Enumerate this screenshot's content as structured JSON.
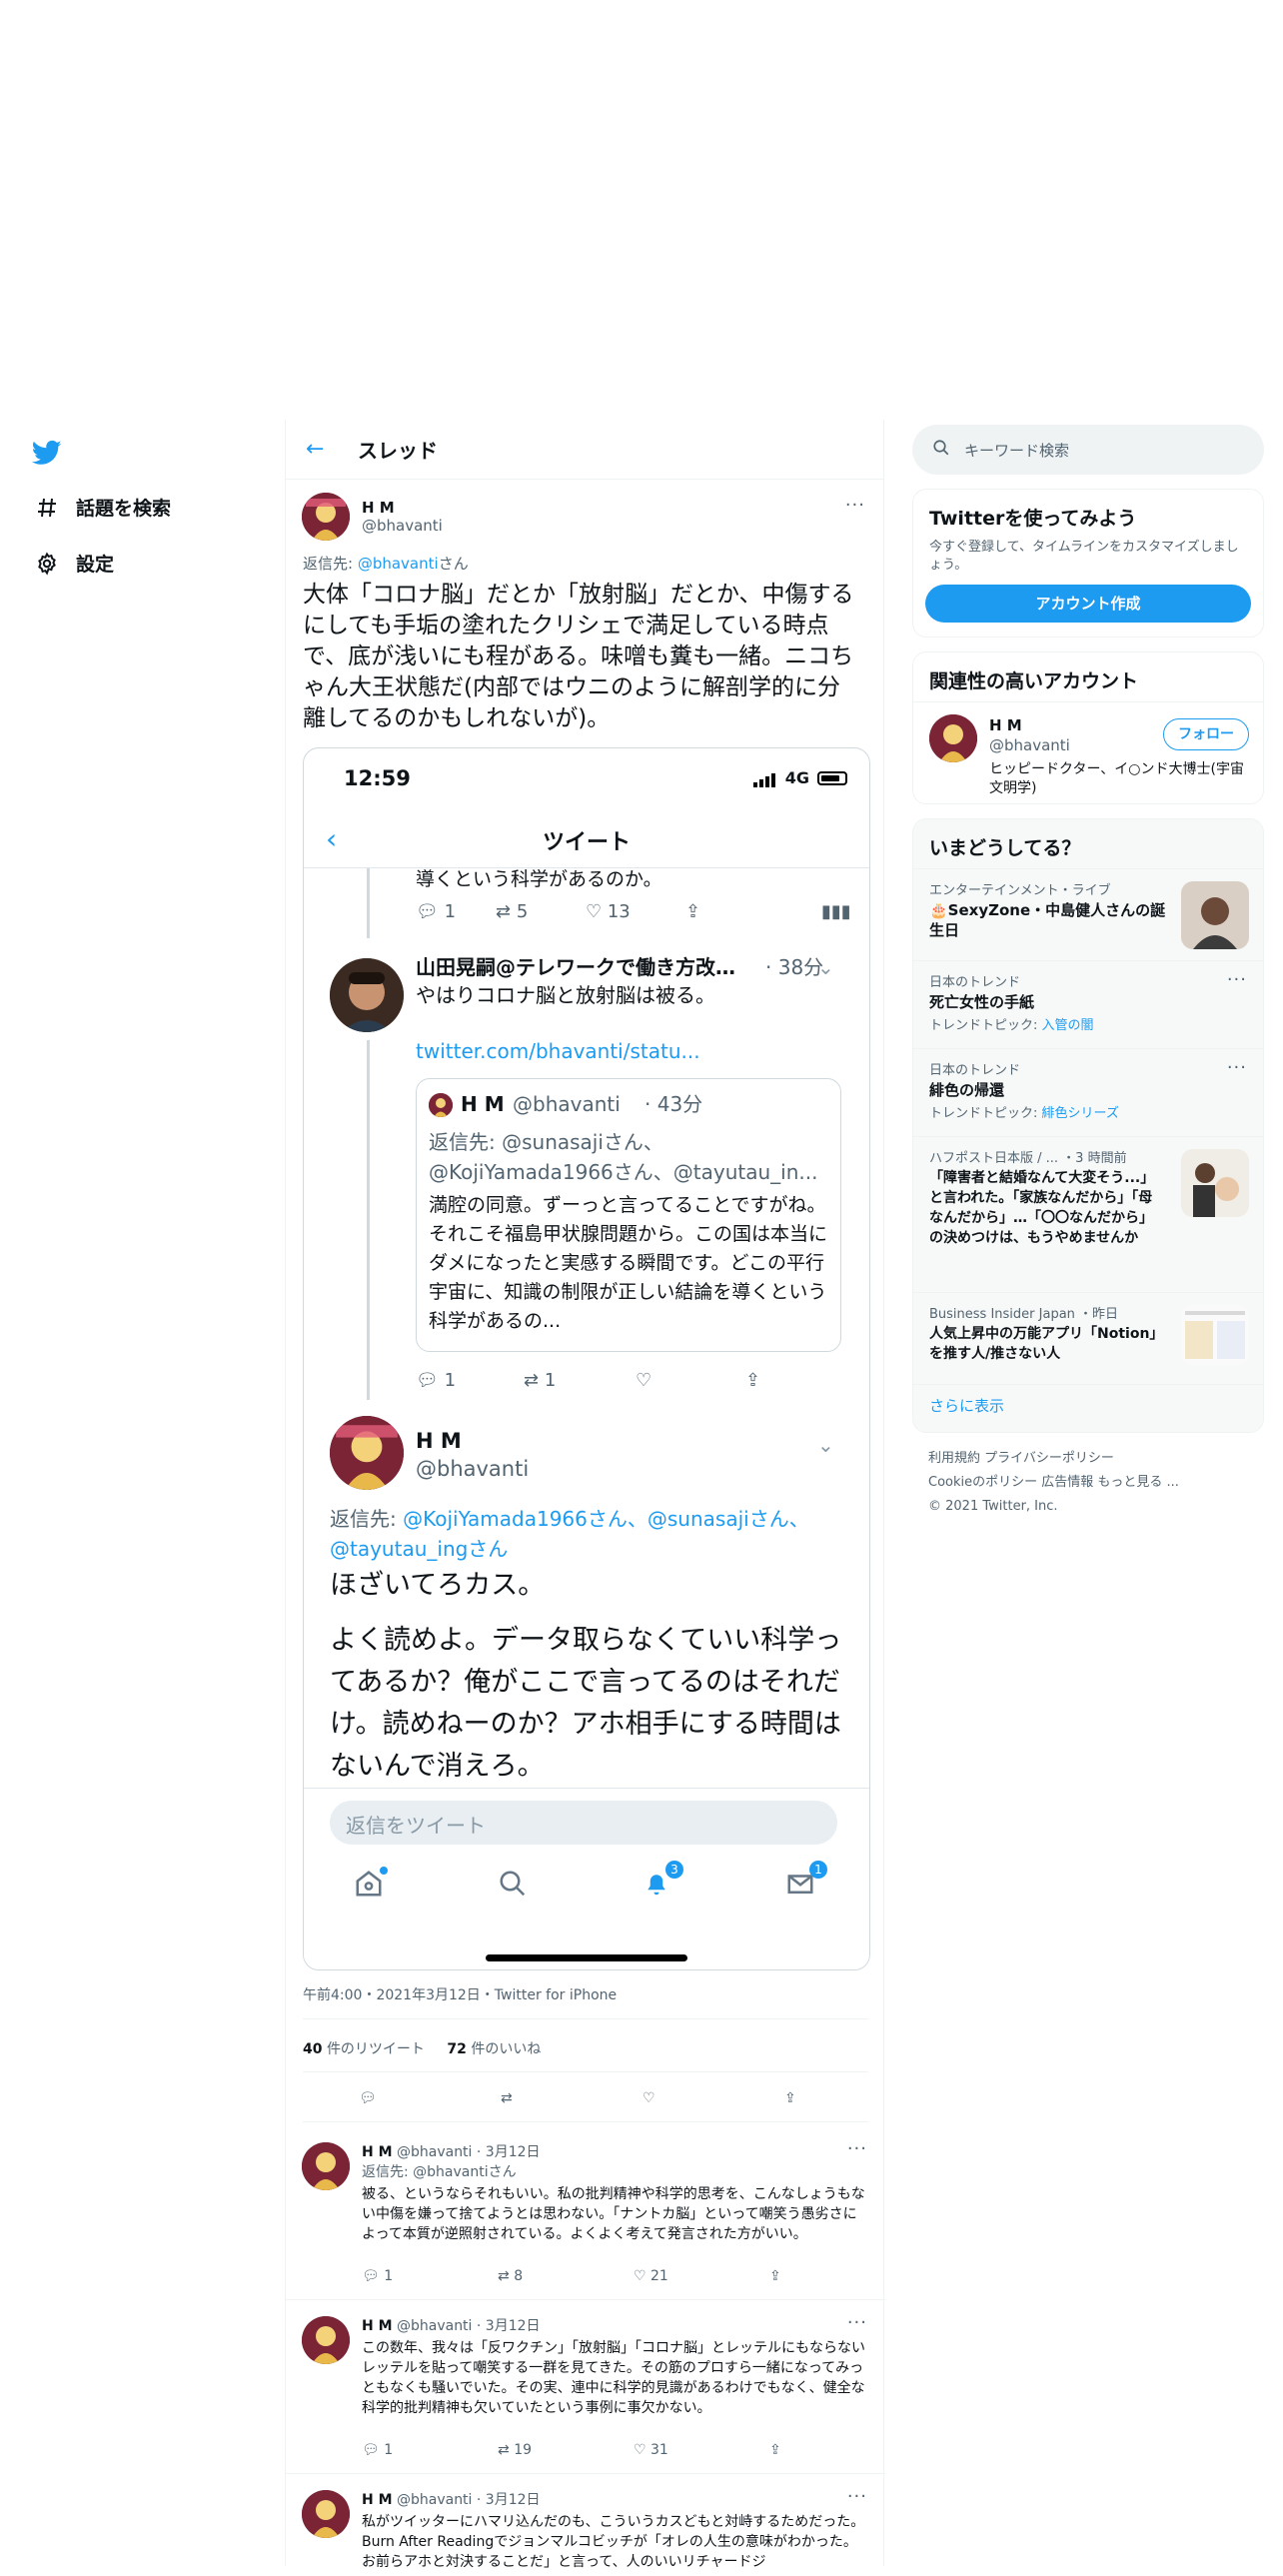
{
  "nav": {
    "items": [
      {
        "icon": "hash-icon",
        "label": "話題を検索"
      },
      {
        "icon": "gear-icon",
        "label": "設定"
      }
    ]
  },
  "header": {
    "title": "スレッド"
  },
  "tweet": {
    "name": "H M",
    "handle": "@bhavanti",
    "reply_prefix": "返信先: ",
    "reply_handle": "@bhavanti",
    "reply_suffix": "さん",
    "text": "大体「コロナ脳」だとか「放射脳」だとか、中傷するにしても手垢の塗れたクリシェで満足している時点で、底が浅いにも程がある。味噌も糞も一緒。ニコちゃん大王状態だ(内部ではウニのように解剖学的に分離してるのかもしれないが)。",
    "meta": "午前4:00・2021年3月12日・Twitter for iPhone",
    "retweets": "40",
    "retweets_label": "件のリツイート",
    "likes": "72",
    "likes_label": "件のいいね"
  },
  "phone": {
    "time": "12:59",
    "network": "4G",
    "title": "ツイート",
    "top_text": "導くという科学があるのか。",
    "top_actions": {
      "reply": "1",
      "retweet": "5",
      "like": "13"
    },
    "t1": {
      "name": "山田晃嗣@テレワークで働き方改…",
      "time": "· 38分",
      "text": "やはりコロナ脳と放射脳は被る。",
      "link": "twitter.com/bhavanti/statu..."
    },
    "quote": {
      "name": "H M",
      "handle": "@bhavanti",
      "time": "· 43分",
      "reply_to_1": "返信先: @sunasajiさん、",
      "reply_to_2": "@KojiYamada1966さん、@tayutau_in...",
      "text": "満腔の同意。ずーっと言ってることですがね。それこそ福島甲状腺問題から。この国は本当にダメになったと実感する瞬間です。どこの平行宇宙に、知識の制限が正しい結論を導くという科学があるの..."
    },
    "t1_actions": {
      "reply": "1",
      "retweet": "1"
    },
    "t2": {
      "name": "H M",
      "handle": "@bhavanti",
      "reply_prefix": "返信先: ",
      "reply_handles": "@KojiYamada1966さん、@sunasajiさん、@tayutau_ingさん",
      "text1": "ほざいてろカス。",
      "text2": "よく読めよ。データ取らなくていい科学ってあるか？俺がここで言ってるのはそれだけ。読めねーのか？アホ相手にする時間はないんで消えろ。"
    },
    "reply_placeholder": "返信をツイート",
    "notif_badge": "3",
    "dm_badge": "1"
  },
  "replies": [
    {
      "name": "H M",
      "handle": "@bhavanti",
      "date": "· 3月12日",
      "reply_to": "返信先: @bhavantiさん",
      "text": "被る、というならそれもいい。私の批判精神や科学的思考を、こんなしょうもない中傷を嫌って捨てようとは思わない。「ナントカ脳」といって嘲笑う愚劣さによって本質が逆照射されている。よくよく考えて発言された方がいい。",
      "reply": "1",
      "retweet": "8",
      "like": "21"
    },
    {
      "name": "H M",
      "handle": "@bhavanti",
      "date": "· 3月12日",
      "reply_to": "",
      "text": "この数年、我々は「反ワクチン」「放射脳」「コロナ脳」とレッテルにもならないレッテルを貼って嘲笑する一群を見てきた。その筋のプロすら一緒になってみっともなくも騒いでいた。その実、連中に科学的見識があるわけでもなく、健全な科学的批判精神も欠いていたという事例に事欠かない。",
      "reply": "1",
      "retweet": "19",
      "like": "31"
    },
    {
      "name": "H M",
      "handle": "@bhavanti",
      "date": "· 3月12日",
      "reply_to": "",
      "text": "私がツイッターにハマリ込んだのも、こういうカスどもと対峙するためだった。Burn After Readingでジョンマルコビッチが「オレの人生の意味がわかった。お前らアホと対決することだ」と言って、人のいいリチャードジ",
      "reply": "",
      "retweet": "",
      "like": ""
    }
  ],
  "right": {
    "search_placeholder": "キーワード検索",
    "signup": {
      "title": "Twitterを使ってみよう",
      "desc": "今すぐ登録して、タイムラインをカスタマイズしましょう。",
      "button": "アカウント作成"
    },
    "related": {
      "title": "関連性の高いアカウント",
      "name": "H M",
      "handle": "@bhavanti",
      "follow": "フォロー",
      "bio": "ヒッピードクター、イ○ンド大博士(宇宙文明学)"
    },
    "trends": {
      "title": "いまどうしてる？",
      "items": [
        {
          "cat": "エンターテインメント・ライブ",
          "title": "🎂SexyZone・中島健人さんの誕生日",
          "sub": ""
        },
        {
          "cat": "日本のトレンド",
          "title": "死亡女性の手紙",
          "sub": "トレンドトピック: ",
          "sub_link": "入管の闇"
        },
        {
          "cat": "日本のトレンド",
          "title": "緋色の帰還",
          "sub": "トレンドトピック: ",
          "sub_link": "緋色シリーズ"
        },
        {
          "cat": "ハフポスト日本版 / ... ・3 時間前",
          "title": "「障害者と結婚なんて大変そう...」と言われた。「家族なんだから」「母なんだから」…「〇〇なんだから」の決めつけは、もうやめませんか",
          "sub": ""
        },
        {
          "cat": "Business Insider Japan ・昨日",
          "title": "人気上昇中の万能アプリ「Notion」を推す人/推さない人",
          "sub": ""
        }
      ],
      "show_more": "さらに表示"
    },
    "footer": {
      "line1": "利用規約   プライバシーポリシー",
      "line2": "Cookieのポリシー   広告情報   もっと見る ...",
      "line3": "© 2021 Twitter, Inc."
    }
  },
  "colors": {
    "accent": "#1d9bf0",
    "text": "#0f1419",
    "muted": "#536471"
  }
}
